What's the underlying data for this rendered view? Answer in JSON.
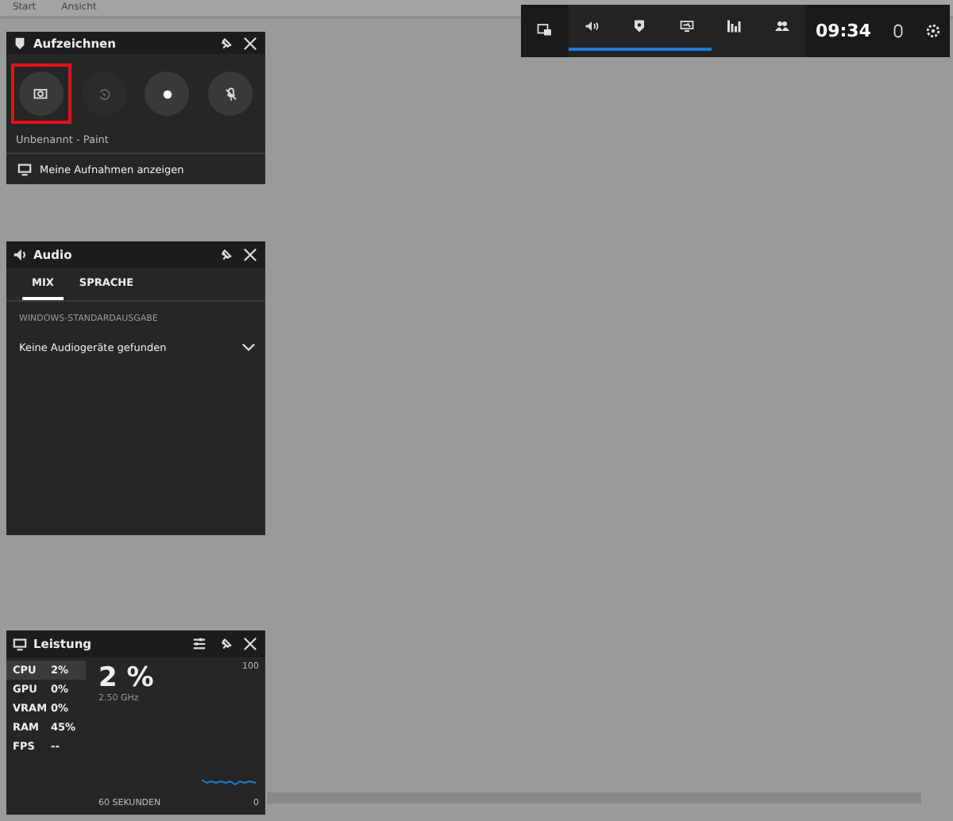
{
  "app_menu": [
    {
      "label": "Start"
    },
    {
      "label": "Ansicht"
    }
  ],
  "toolbar": {
    "items": [
      {
        "kind": "widgets",
        "on": false
      },
      {
        "kind": "audio",
        "on": true
      },
      {
        "kind": "capture",
        "on": true
      },
      {
        "kind": "performance",
        "on": true
      },
      {
        "kind": "resources",
        "on": false
      },
      {
        "kind": "social",
        "on": false
      }
    ],
    "time": "09:34",
    "trailing": [
      {
        "kind": "mouse"
      },
      {
        "kind": "settings"
      }
    ]
  },
  "capture_panel": {
    "title": "Aufzeichnen",
    "buttons": [
      {
        "kind": "screenshot",
        "disabled": false,
        "highlighted": true
      },
      {
        "kind": "record_last",
        "disabled": true,
        "highlighted": false
      },
      {
        "kind": "record",
        "disabled": false,
        "highlighted": false
      },
      {
        "kind": "mic",
        "disabled": false,
        "highlighted": false
      }
    ],
    "source": "Unbenannt - Paint",
    "link": "Meine Aufnahmen anzeigen"
  },
  "audio_panel": {
    "title": "Audio",
    "tabs": [
      {
        "label": "MIX",
        "selected": true
      },
      {
        "label": "SPRACHE",
        "selected": false
      }
    ],
    "section": "WINDOWS-STANDARDAUSGABE",
    "device": "Keine Audiogeräte gefunden"
  },
  "performance_panel": {
    "title": "Leistung",
    "metrics": [
      {
        "label": "CPU",
        "value": "2%",
        "selected": true
      },
      {
        "label": "GPU",
        "value": "0%",
        "selected": false
      },
      {
        "label": "VRAM",
        "value": "0%",
        "selected": false
      },
      {
        "label": "RAM",
        "value": "45%",
        "selected": false
      },
      {
        "label": "FPS",
        "value": "--",
        "selected": false
      }
    ],
    "big_value": "2 %",
    "frequency": "2.50 GHz",
    "y_max": "100",
    "y_min": "0",
    "x_label": "60 SEKUNDEN"
  }
}
